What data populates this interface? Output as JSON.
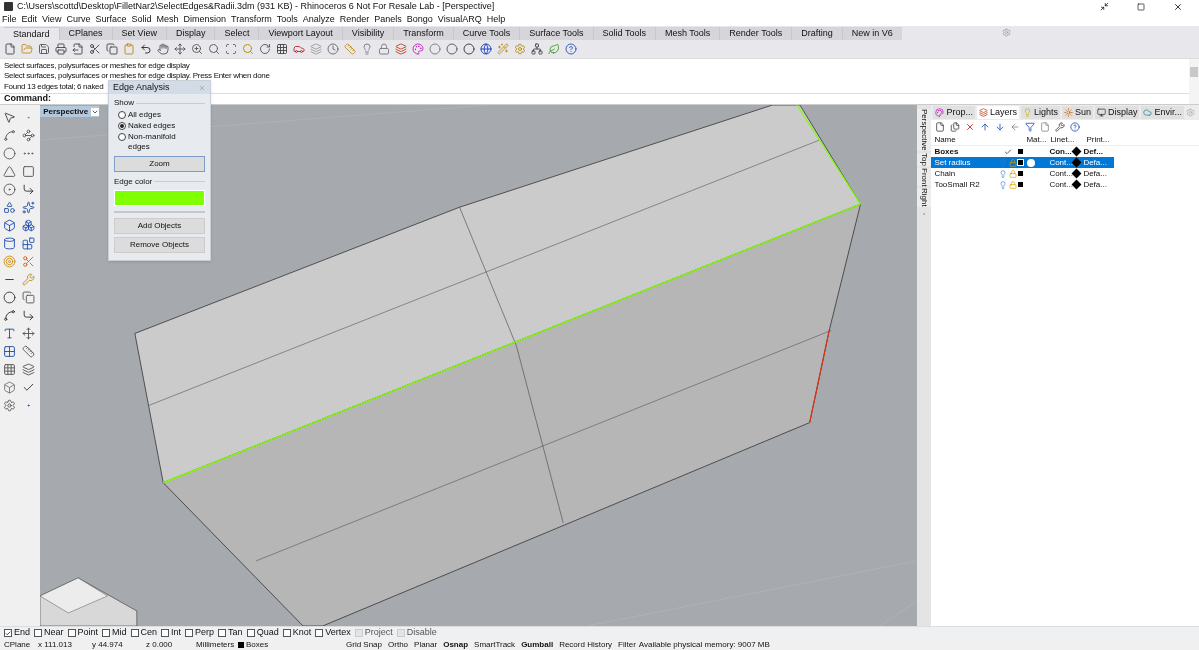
{
  "window": {
    "title": "C:\\Users\\scottd\\Desktop\\FilletNar2\\SelectEdges&Radii.3dm (931 KB) - Rhinoceros 6 Not For Resale Lab - [Perspective]"
  },
  "menu": [
    "File",
    "Edit",
    "View",
    "Curve",
    "Surface",
    "Solid",
    "Mesh",
    "Dimension",
    "Transform",
    "Tools",
    "Analyze",
    "Render",
    "Panels",
    "Bongo",
    "VisualARQ",
    "Help"
  ],
  "toolbar_tabs": [
    {
      "label": "Standard",
      "selected": true
    },
    {
      "label": "CPlanes",
      "selected": false
    },
    {
      "label": "Set View",
      "selected": false
    },
    {
      "label": "Display",
      "selected": false
    },
    {
      "label": "Select",
      "selected": false
    },
    {
      "label": "Viewport Layout",
      "selected": false
    },
    {
      "label": "Visibility",
      "selected": false
    },
    {
      "label": "Transform",
      "selected": false
    },
    {
      "label": "Curve Tools",
      "selected": false
    },
    {
      "label": "Surface Tools",
      "selected": false
    },
    {
      "label": "Solid Tools",
      "selected": false
    },
    {
      "label": "Mesh Tools",
      "selected": false
    },
    {
      "label": "Render Tools",
      "selected": false
    },
    {
      "label": "Drafting",
      "selected": false
    },
    {
      "label": "New in V6",
      "selected": false
    }
  ],
  "command_history": [
    "Select surfaces, polysurfaces or meshes for edge display",
    "Select surfaces, polysurfaces or meshes for edge display. Press Enter when done",
    "Found 13 edges total; 6 naked"
  ],
  "command_prompt": "Command:",
  "viewport": {
    "title": "Perspective"
  },
  "edge_analysis": {
    "title": "Edge Analysis",
    "group": "Show",
    "options": [
      {
        "label": "All edges",
        "selected": false
      },
      {
        "label": "Naked edges",
        "selected": true
      },
      {
        "label": "Non-manifold edges",
        "selected": false
      }
    ],
    "zoom_button": "Zoom",
    "color_label": "Edge color",
    "buttons": [
      "Add Objects",
      "Remove Objects"
    ]
  },
  "viewport_tabs": [
    "Perspective",
    "Top",
    "Front",
    "Right"
  ],
  "panel_tabs": [
    {
      "label": "Prop...",
      "selected": false
    },
    {
      "label": "Layers",
      "selected": true
    },
    {
      "label": "Lights",
      "selected": false
    },
    {
      "label": "Sun",
      "selected": false
    },
    {
      "label": "Display",
      "selected": false
    },
    {
      "label": "Envir...",
      "selected": false
    }
  ],
  "layers": {
    "columns": [
      "Name",
      "Mat...",
      "Linet...",
      "Print..."
    ],
    "rows": [
      {
        "name": "Boxes",
        "current": true,
        "selected": false,
        "linetype": "Con...",
        "print": "Def..."
      },
      {
        "name": "Set radius",
        "current": false,
        "selected": true,
        "linetype": "Cont...",
        "print": "Defa..."
      },
      {
        "name": "Chain",
        "current": false,
        "selected": false,
        "linetype": "Cont...",
        "print": "Defa..."
      },
      {
        "name": "TooSmall R2",
        "current": false,
        "selected": false,
        "linetype": "Cont...",
        "print": "Defa..."
      }
    ]
  },
  "osnaps": [
    {
      "label": "End",
      "checked": true,
      "disabled": false
    },
    {
      "label": "Near",
      "checked": false,
      "disabled": false
    },
    {
      "label": "Point",
      "checked": false,
      "disabled": false
    },
    {
      "label": "Mid",
      "checked": false,
      "disabled": false
    },
    {
      "label": "Cen",
      "checked": false,
      "disabled": false
    },
    {
      "label": "Int",
      "checked": false,
      "disabled": false
    },
    {
      "label": "Perp",
      "checked": false,
      "disabled": false
    },
    {
      "label": "Tan",
      "checked": false,
      "disabled": false
    },
    {
      "label": "Quad",
      "checked": false,
      "disabled": false
    },
    {
      "label": "Knot",
      "checked": false,
      "disabled": false
    },
    {
      "label": "Vertex",
      "checked": false,
      "disabled": false
    },
    {
      "label": "Project",
      "checked": false,
      "disabled": true
    },
    {
      "label": "Disable",
      "checked": false,
      "disabled": true
    }
  ],
  "status_bar": {
    "cplane": "CPlane",
    "x": "x 111.013",
    "y": "y 44.974",
    "z": "z 0.000",
    "units": "Millimeters",
    "layer": "Boxes",
    "toggles": [
      {
        "label": "Grid Snap",
        "on": false
      },
      {
        "label": "Ortho",
        "on": false
      },
      {
        "label": "Planar",
        "on": false
      },
      {
        "label": "Osnap",
        "on": true
      },
      {
        "label": "SmartTrack",
        "on": false
      },
      {
        "label": "Gumball",
        "on": true
      },
      {
        "label": "Record History",
        "on": false
      },
      {
        "label": "Filter",
        "on": false
      }
    ],
    "memory": "Available physical memory: 9007 MB"
  }
}
